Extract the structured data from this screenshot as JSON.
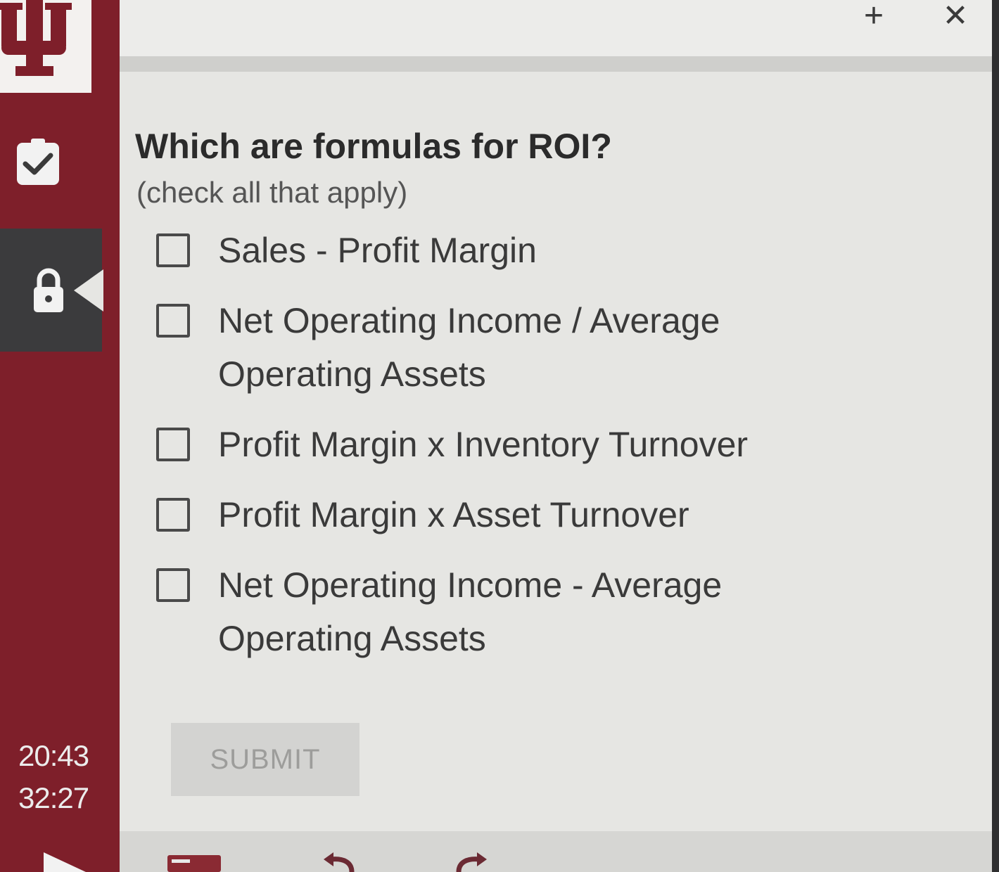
{
  "window": {
    "plus_icon": "plus-icon",
    "close_icon": "close-icon"
  },
  "sidebar": {
    "logo": "iu-trident-logo",
    "tabs": [
      {
        "icon": "clipboard-check-icon"
      },
      {
        "icon": "lock-icon"
      }
    ],
    "timer_elapsed": "20:43",
    "timer_remaining": "32:27"
  },
  "question": {
    "title": "Which are formulas for ROI?",
    "hint": "(check all that apply)",
    "options": [
      {
        "label": "Sales - Profit Margin",
        "checked": false
      },
      {
        "label": "Net Operating Income / Average Operating Assets",
        "checked": false
      },
      {
        "label": "Profit Margin x Inventory Turnover",
        "checked": false
      },
      {
        "label": "Profit Margin x Asset Turnover",
        "checked": false
      },
      {
        "label": "Net Operating Income - Average Operating Assets",
        "checked": false
      }
    ],
    "submit_label": "SUBMIT"
  },
  "colors": {
    "sidebar": "#7e1f2a",
    "active_tab": "#3b3b3d",
    "background": "#e6e6e3"
  }
}
